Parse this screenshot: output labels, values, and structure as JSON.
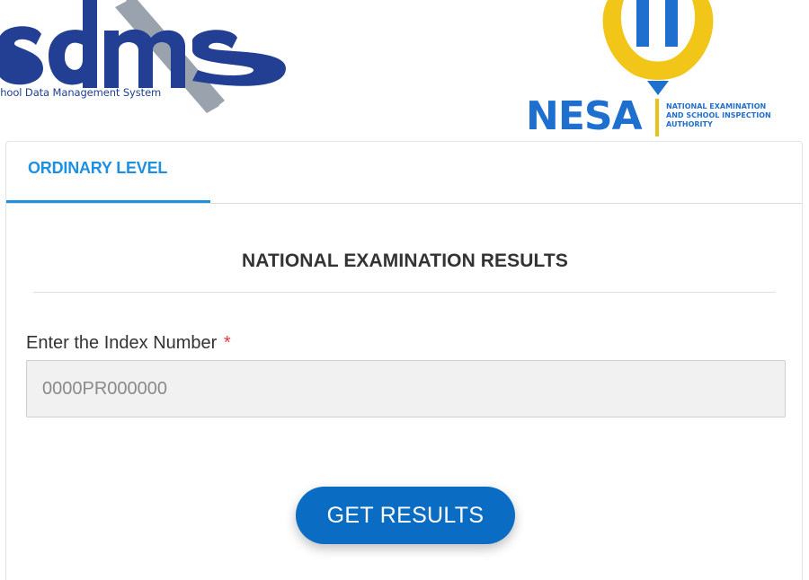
{
  "logos": {
    "sdms_tagline": "chool Data Management System",
    "nesa_name": "NESA",
    "nesa_subtitle_lines": [
      "NATIONAL EXAMINATION",
      "AND SCHOOL INSPECTION",
      "AUTHORITY"
    ]
  },
  "tabs": [
    {
      "label": "ORDINARY LEVEL",
      "active": true
    }
  ],
  "form": {
    "title": "NATIONAL EXAMINATION RESULTS",
    "index_label": "Enter the Index Number",
    "required_mark": "*",
    "index_value": "",
    "index_placeholder": "0000PR000000",
    "submit_label": "GET RESULTS"
  },
  "colors": {
    "accent": "#1e90e0",
    "button": "#0a6cc2",
    "sdms_blue": "#1f3f8f",
    "nesa_blue": "#1f6fcf",
    "nesa_yellow": "#e8c21a",
    "required": "#e03b3b"
  }
}
